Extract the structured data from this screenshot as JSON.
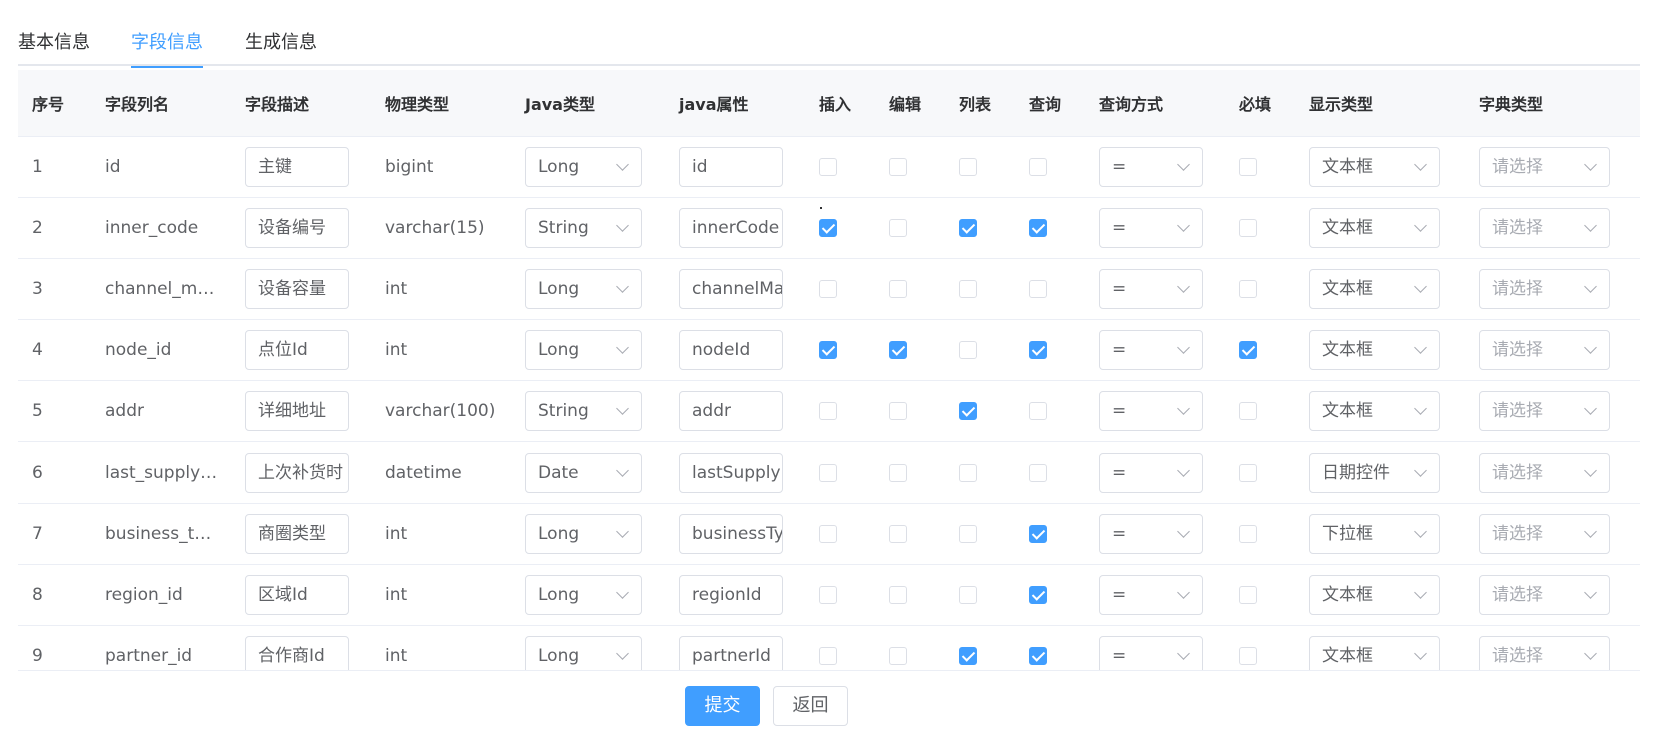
{
  "tabs": [
    {
      "label": "基本信息",
      "active": false
    },
    {
      "label": "字段信息",
      "active": true
    },
    {
      "label": "生成信息",
      "active": false
    }
  ],
  "table": {
    "headers": [
      "序号",
      "字段列名",
      "字段描述",
      "物理类型",
      "Java类型",
      "java属性",
      "插入",
      "编辑",
      "列表",
      "查询",
      "查询方式",
      "必填",
      "显示类型",
      "字典类型"
    ],
    "rows": [
      {
        "index": "1",
        "column": "id",
        "desc": "主键",
        "phys": "bigint",
        "javaType": "Long",
        "javaProp": "id",
        "insert": false,
        "edit": false,
        "list": false,
        "query": false,
        "queryType": "=",
        "required": false,
        "display": "文本框",
        "dict": "请选择"
      },
      {
        "index": "2",
        "column": "inner_code",
        "desc": "设备编号",
        "phys": "varchar(15)",
        "javaType": "String",
        "javaProp": "innerCode",
        "insert": true,
        "edit": false,
        "list": true,
        "query": true,
        "queryType": "=",
        "required": false,
        "display": "文本框",
        "dict": "请选择"
      },
      {
        "index": "3",
        "column": "channel_m…",
        "desc": "设备容量",
        "phys": "int",
        "javaType": "Long",
        "javaProp": "channelMa",
        "insert": false,
        "edit": false,
        "list": false,
        "query": false,
        "queryType": "=",
        "required": false,
        "display": "文本框",
        "dict": "请选择"
      },
      {
        "index": "4",
        "column": "node_id",
        "desc": "点位Id",
        "phys": "int",
        "javaType": "Long",
        "javaProp": "nodeId",
        "insert": true,
        "edit": true,
        "list": false,
        "query": true,
        "queryType": "=",
        "required": true,
        "display": "文本框",
        "dict": "请选择"
      },
      {
        "index": "5",
        "column": "addr",
        "desc": "详细地址",
        "phys": "varchar(100)",
        "javaType": "String",
        "javaProp": "addr",
        "insert": false,
        "edit": false,
        "list": true,
        "query": false,
        "queryType": "=",
        "required": false,
        "display": "文本框",
        "dict": "请选择"
      },
      {
        "index": "6",
        "column": "last_supply…",
        "desc": "上次补货时",
        "phys": "datetime",
        "javaType": "Date",
        "javaProp": "lastSupply",
        "insert": false,
        "edit": false,
        "list": false,
        "query": false,
        "queryType": "=",
        "required": false,
        "display": "日期控件",
        "dict": "请选择"
      },
      {
        "index": "7",
        "column": "business_t…",
        "desc": "商圈类型",
        "phys": "int",
        "javaType": "Long",
        "javaProp": "businessTy",
        "insert": false,
        "edit": false,
        "list": false,
        "query": true,
        "queryType": "=",
        "required": false,
        "display": "下拉框",
        "dict": "请选择"
      },
      {
        "index": "8",
        "column": "region_id",
        "desc": "区域Id",
        "phys": "int",
        "javaType": "Long",
        "javaProp": "regionId",
        "insert": false,
        "edit": false,
        "list": false,
        "query": true,
        "queryType": "=",
        "required": false,
        "display": "文本框",
        "dict": "请选择"
      },
      {
        "index": "9",
        "column": "partner_id",
        "desc": "合作商Id",
        "phys": "int",
        "javaType": "Long",
        "javaProp": "partnerId",
        "insert": false,
        "edit": false,
        "list": true,
        "query": true,
        "queryType": "=",
        "required": false,
        "display": "文本框",
        "dict": "请选择"
      }
    ]
  },
  "buttons": {
    "submit": "提交",
    "back": "返回"
  },
  "colors": {
    "accent": "#409eff",
    "border": "#dcdfe6",
    "header_bg": "#f7f8fa"
  }
}
